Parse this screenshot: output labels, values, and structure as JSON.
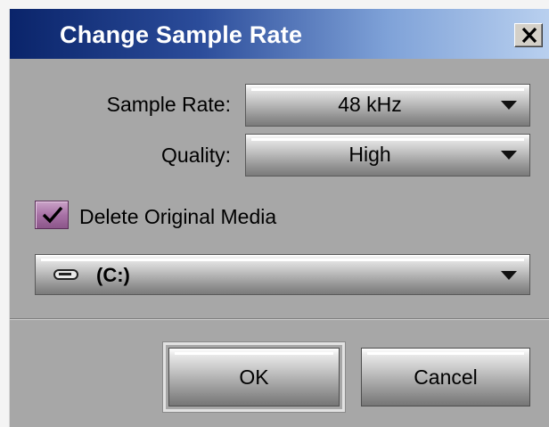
{
  "dialog": {
    "title": "Change Sample Rate",
    "close_glyph": "✕",
    "sample_rate": {
      "label": "Sample Rate:",
      "value": "48 kHz"
    },
    "quality": {
      "label": "Quality:",
      "value": "High"
    },
    "delete_original": {
      "label": "Delete Original Media",
      "checked": true
    },
    "drive": {
      "icon": "drive-icon",
      "value": "(C:)"
    },
    "buttons": {
      "ok": "OK",
      "cancel": "Cancel"
    }
  },
  "colors": {
    "titlebar_start": "#0a246a",
    "titlebar_end": "#b9d0ef",
    "dialog_bg": "#a7a7a7",
    "checkbox_accent": "#a872a6"
  }
}
